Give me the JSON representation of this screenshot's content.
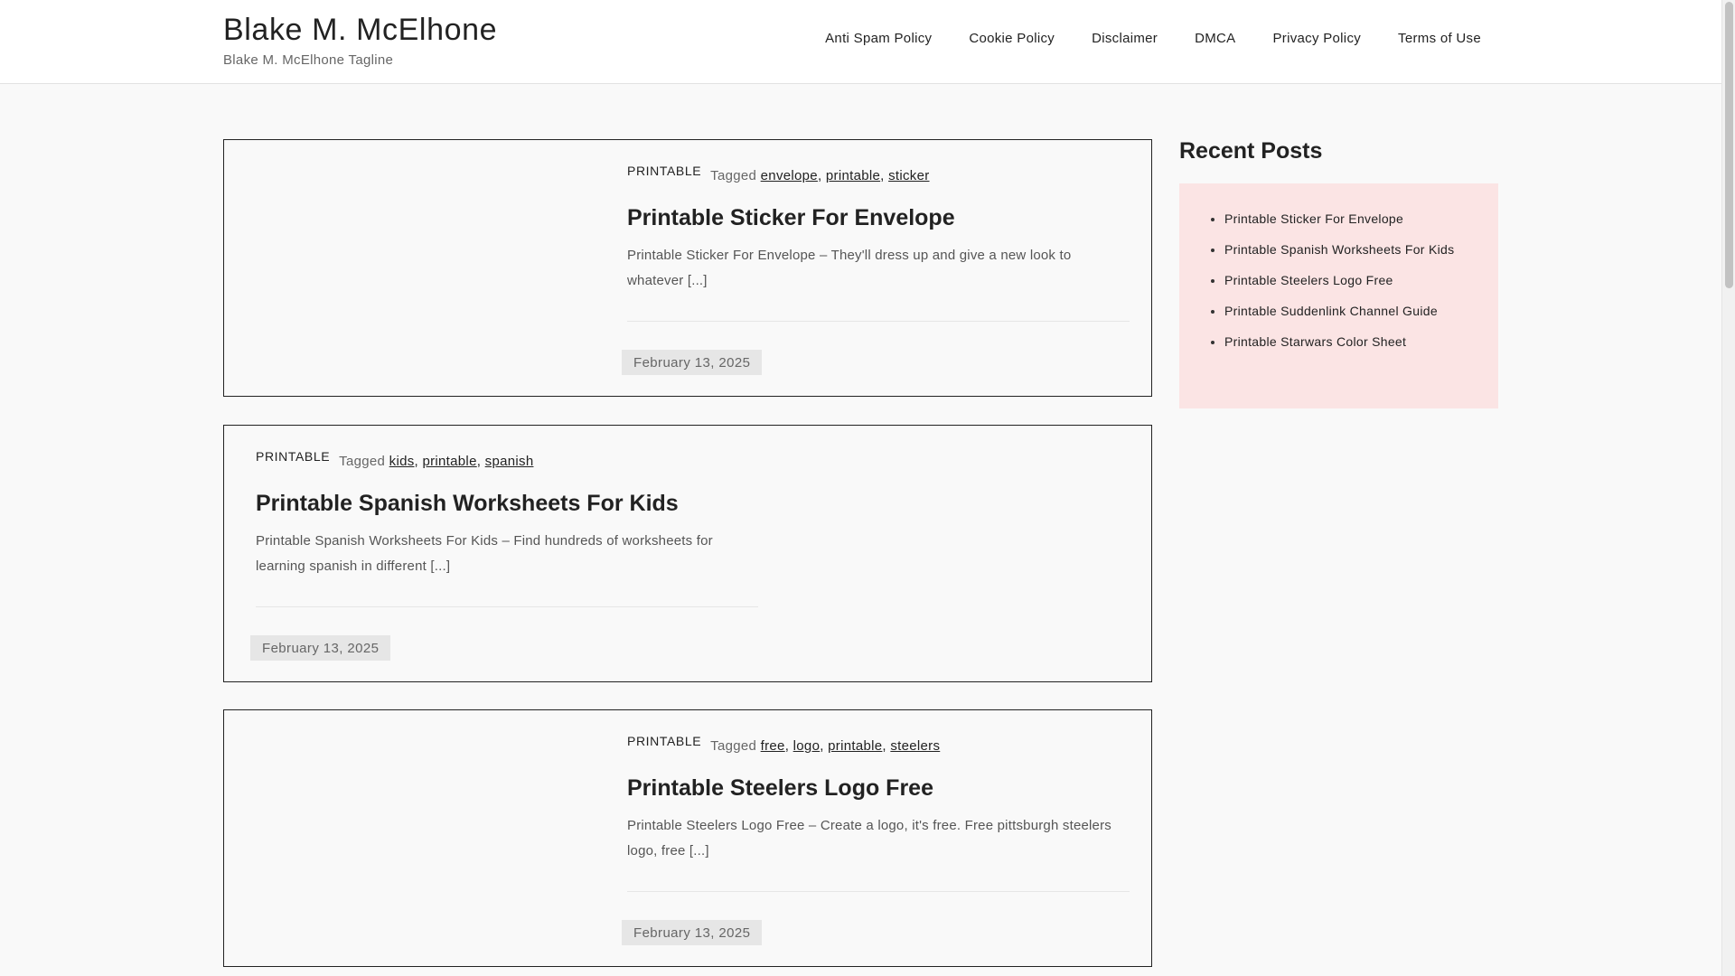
{
  "header": {
    "site_title": "Blake M. McElhone",
    "tagline": "Blake M. McElhone Tagline",
    "nav": [
      "Anti Spam Policy",
      "Cookie Policy",
      "Disclaimer",
      "DMCA",
      "Privacy Policy",
      "Terms of Use"
    ]
  },
  "posts": [
    {
      "category": "PRINTABLE",
      "tagged_label": "Tagged",
      "tags": [
        "envelope",
        "printable",
        "sticker"
      ],
      "title": "Printable Sticker For Envelope",
      "excerpt": "Printable Sticker For Envelope – They'll dress up and give a new look to whatever [...]",
      "date": "February 13, 2025"
    },
    {
      "category": "PRINTABLE",
      "tagged_label": "Tagged",
      "tags": [
        "kids",
        "printable",
        "spanish"
      ],
      "title": "Printable Spanish Worksheets For Kids",
      "excerpt": "Printable Spanish Worksheets For Kids – Find hundreds of worksheets for learning spanish in different [...]",
      "date": "February 13, 2025"
    },
    {
      "category": "PRINTABLE",
      "tagged_label": "Tagged",
      "tags": [
        "free",
        "logo",
        "printable",
        "steelers"
      ],
      "title": "Printable Steelers Logo Free",
      "excerpt": "Printable Steelers Logo Free – Create a logo, it's free. Free pittsburgh steelers logo, free [...]",
      "date": "February 13, 2025"
    }
  ],
  "sidebar": {
    "title": "Recent Posts",
    "items": [
      "Printable Sticker For Envelope",
      "Printable Spanish Worksheets For Kids",
      "Printable Steelers Logo Free",
      "Printable Suddenlink Channel Guide",
      "Printable Starwars Color Sheet"
    ]
  }
}
